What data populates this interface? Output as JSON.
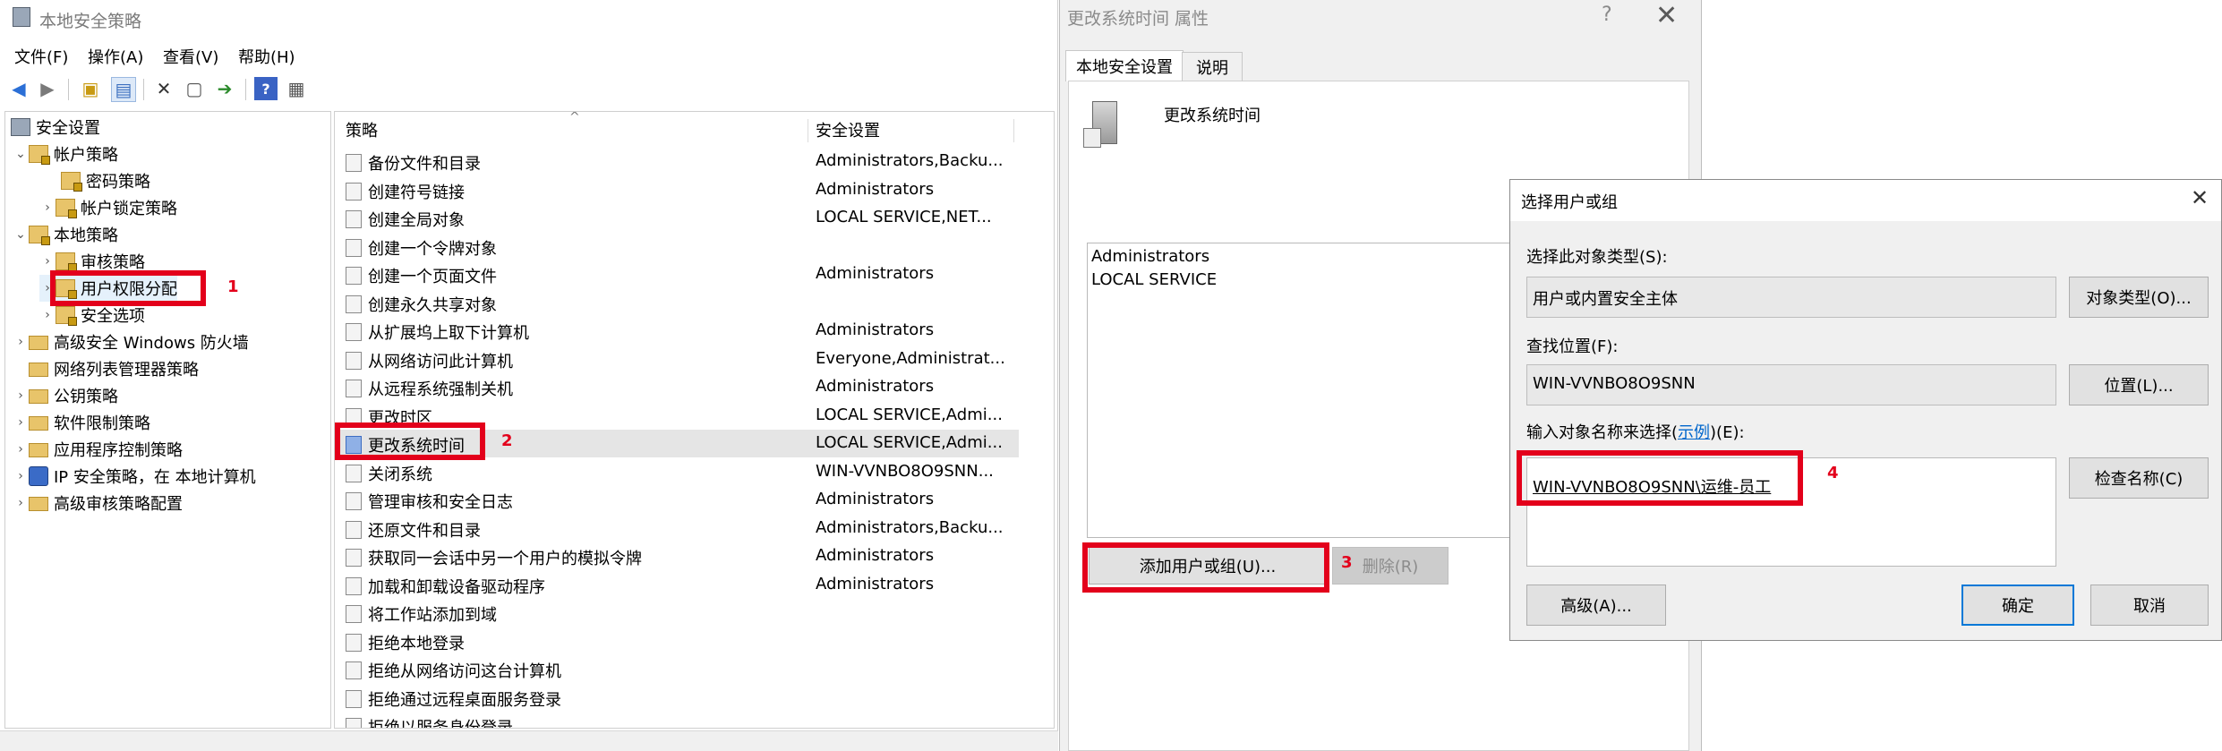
{
  "main_window": {
    "title": "本地安全策略",
    "menu": [
      "文件(F)",
      "操作(A)",
      "查看(V)",
      "帮助(H)"
    ],
    "tree": {
      "root": "安全设置",
      "account_policies": "帐户策略",
      "password_policy": "密码策略",
      "lockout_policy": "帐户锁定策略",
      "local_policies": "本地策略",
      "audit_policy": "审核策略",
      "user_rights": "用户权限分配",
      "security_options": "安全选项",
      "firewall": "高级安全 Windows 防火墙",
      "network_list": "网络列表管理器策略",
      "public_key": "公钥策略",
      "software_restriction": "软件限制策略",
      "app_control": "应用程序控制策略",
      "ipsec": "IP 安全策略，在 本地计算机",
      "advanced_audit": "高级审核策略配置"
    },
    "list": {
      "col_policy": "策略",
      "col_setting": "安全设置",
      "rows": [
        {
          "policy": "备份文件和目录",
          "setting": "Administrators,Backu..."
        },
        {
          "policy": "创建符号链接",
          "setting": "Administrators"
        },
        {
          "policy": "创建全局对象",
          "setting": "LOCAL SERVICE,NET..."
        },
        {
          "policy": "创建一个令牌对象",
          "setting": ""
        },
        {
          "policy": "创建一个页面文件",
          "setting": "Administrators"
        },
        {
          "policy": "创建永久共享对象",
          "setting": ""
        },
        {
          "policy": "从扩展坞上取下计算机",
          "setting": "Administrators"
        },
        {
          "policy": "从网络访问此计算机",
          "setting": "Everyone,Administrat..."
        },
        {
          "policy": "从远程系统强制关机",
          "setting": "Administrators"
        },
        {
          "policy": "更改时区",
          "setting": "LOCAL SERVICE,Admi..."
        },
        {
          "policy": "更改系统时间",
          "setting": "LOCAL SERVICE,Admi..."
        },
        {
          "policy": "关闭系统",
          "setting": "WIN-VVNBO8O9SNN..."
        },
        {
          "policy": "管理审核和安全日志",
          "setting": "Administrators"
        },
        {
          "policy": "还原文件和目录",
          "setting": "Administrators,Backu..."
        },
        {
          "policy": "获取同一会话中另一个用户的模拟令牌",
          "setting": "Administrators"
        },
        {
          "policy": "加载和卸载设备驱动程序",
          "setting": "Administrators"
        },
        {
          "policy": "将工作站添加到域",
          "setting": ""
        },
        {
          "policy": "拒绝本地登录",
          "setting": ""
        },
        {
          "policy": "拒绝从网络访问这台计算机",
          "setting": ""
        },
        {
          "policy": "拒绝通过远程桌面服务登录",
          "setting": ""
        },
        {
          "policy": "拒绝以服务身份登录",
          "setting": ""
        }
      ]
    }
  },
  "props_dialog": {
    "title": "更改系统时间 属性",
    "help": "?",
    "close": "✕",
    "tab_local": "本地安全设置",
    "tab_explain": "说明",
    "policy_name": "更改系统时间",
    "members": [
      "Administrators",
      "LOCAL SERVICE"
    ],
    "add_button": "添加用户或组(U)...",
    "remove_button": "删除(R)"
  },
  "select_dialog": {
    "title": "选择用户或组",
    "close": "✕",
    "object_type_label": "选择此对象类型(S):",
    "object_type_value": "用户或内置安全主体",
    "object_type_button": "对象类型(O)...",
    "location_label": "查找位置(F):",
    "location_value": "WIN-VVNBO8O9SNN",
    "location_button": "位置(L)...",
    "names_label_pre": "输入对象名称来选择(",
    "names_label_link": "示例",
    "names_label_post": ")(E):",
    "names_value": "WIN-VVNBO8O9SNN\\运维-员工",
    "check_names_button": "检查名称(C)",
    "advanced_button": "高级(A)...",
    "ok_button": "确定",
    "cancel_button": "取消"
  },
  "annotations": {
    "n1": "1",
    "n2": "2",
    "n3": "3",
    "n4": "4"
  },
  "colors": {
    "annotation_red": "#e3001b",
    "accent_blue": "#0078d7"
  }
}
